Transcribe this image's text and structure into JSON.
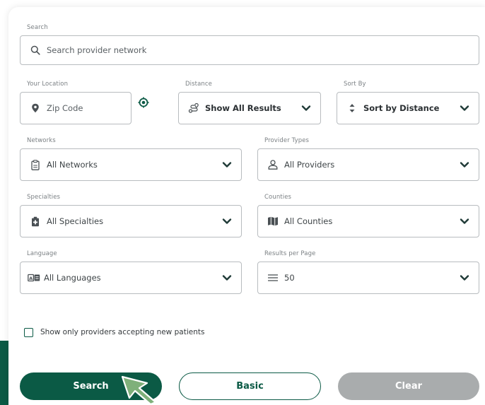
{
  "colors": {
    "brand_green": "#0b5a45",
    "clear_gray": "#a9acad",
    "cursor_green": "#7fb07a"
  },
  "search": {
    "label": "Search",
    "placeholder": "Search provider network",
    "icon": "search-icon"
  },
  "location": {
    "label": "Your Location",
    "placeholder": "Zip Code",
    "icon": "map-pin-icon",
    "locate_icon": "crosshair-icon"
  },
  "distance": {
    "label": "Distance",
    "value": "Show All Results",
    "icon": "route-icon"
  },
  "sort": {
    "label": "Sort By",
    "value": "Sort by Distance",
    "icon": "sort-arrows-icon"
  },
  "networks": {
    "label": "Networks",
    "value": "All Networks",
    "icon": "clipboard-icon"
  },
  "provider_types": {
    "label": "Provider Types",
    "value": "All Providers",
    "icon": "user-icon"
  },
  "specialties": {
    "label": "Specialties",
    "value": "All Specialties",
    "icon": "medical-kit-icon"
  },
  "counties": {
    "label": "Counties",
    "value": "All Counties",
    "icon": "map-icon"
  },
  "language": {
    "label": "Language",
    "value": "All Languages",
    "icon": "language-icon"
  },
  "results_per_page": {
    "label": "Results per Page",
    "value": "50",
    "icon": "list-icon"
  },
  "accepting_new": {
    "label": "Show only providers accepting new patients",
    "checked": false
  },
  "buttons": {
    "search": "Search",
    "basic": "Basic",
    "clear": "Clear"
  }
}
